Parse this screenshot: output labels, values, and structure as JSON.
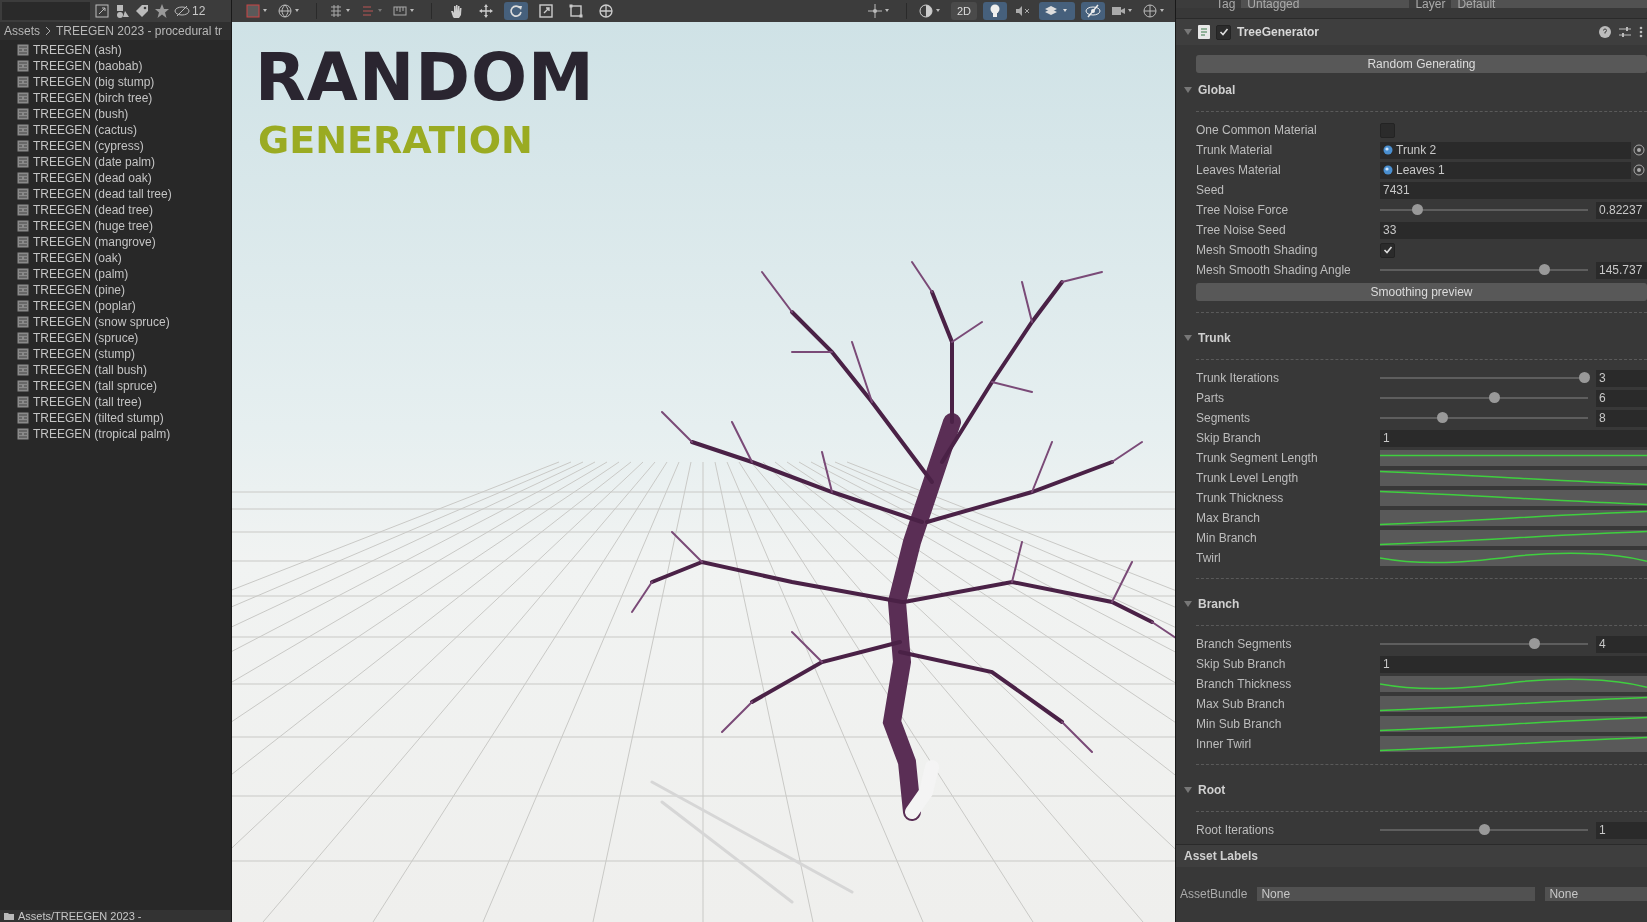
{
  "project": {
    "toolbar_badge": "12",
    "breadcrumb": [
      "Assets",
      "TREEGEN 2023 - procedural tr"
    ],
    "items": [
      "TREEGEN (ash)",
      "TREEGEN (baobab)",
      "TREEGEN (big stump)",
      "TREEGEN (birch tree)",
      "TREEGEN (bush)",
      "TREEGEN (cactus)",
      "TREEGEN (cypress)",
      "TREEGEN (date palm)",
      "TREEGEN (dead oak)",
      "TREEGEN (dead tall tree)",
      "TREEGEN (dead tree)",
      "TREEGEN (huge tree)",
      "TREEGEN (mangrove)",
      "TREEGEN (oak)",
      "TREEGEN (palm)",
      "TREEGEN (pine)",
      "TREEGEN (poplar)",
      "TREEGEN (snow spruce)",
      "TREEGEN (spruce)",
      "TREEGEN (stump)",
      "TREEGEN (tall bush)",
      "TREEGEN (tall spruce)",
      "TREEGEN (tall tree)",
      "TREEGEN (tilted stump)",
      "TREEGEN (tropical palm)"
    ],
    "footer_path": "Assets/TREEGEN 2023 -"
  },
  "scene": {
    "tools": [
      {
        "kind": "hand",
        "selected": false
      },
      {
        "kind": "move",
        "selected": false
      },
      {
        "kind": "rotate",
        "selected": true
      },
      {
        "kind": "scale",
        "selected": false
      },
      {
        "kind": "rect",
        "selected": false
      },
      {
        "kind": "transform",
        "selected": false
      }
    ],
    "mode_button": "2D",
    "lighting_on": true,
    "visibility_on": true,
    "title": "RANDOM",
    "subtitle": "GENERATION"
  },
  "inspector": {
    "tag_label": "Tag",
    "tag_value": "Untagged",
    "layer_label": "Layer",
    "layer_value": "Default",
    "component": {
      "name": "TreeGenerator",
      "enabled": true
    },
    "action_button": "Random Generating",
    "sections": [
      {
        "title": "Global",
        "expanded": true,
        "rows": [
          {
            "kind": "checkbox",
            "label": "One Common Material",
            "checked": false
          },
          {
            "kind": "object",
            "label": "Trunk Material",
            "value": "Trunk 2"
          },
          {
            "kind": "object",
            "label": "Leaves Material",
            "value": "Leaves 1"
          },
          {
            "kind": "field",
            "label": "Seed",
            "value": "7431"
          },
          {
            "kind": "slider",
            "label": "Tree Noise Force",
            "level": 0.18,
            "value": "0.82237"
          },
          {
            "kind": "field",
            "label": "Tree Noise Seed",
            "value": "33"
          },
          {
            "kind": "checkbox",
            "label": "Mesh Smooth Shading",
            "checked": true
          },
          {
            "kind": "slider",
            "label": "Mesh Smooth Shading Angle",
            "level": 0.79,
            "value": "145.737"
          },
          {
            "kind": "button",
            "label": "Smoothing preview"
          }
        ]
      },
      {
        "title": "Trunk",
        "expanded": true,
        "rows": [
          {
            "kind": "slider",
            "label": "Trunk Iterations",
            "level": 0.98,
            "value": "3"
          },
          {
            "kind": "slider",
            "label": "Parts",
            "level": 0.55,
            "value": "6"
          },
          {
            "kind": "slider",
            "label": "Segments",
            "level": 0.3,
            "value": "8"
          },
          {
            "kind": "field",
            "label": "Skip Branch",
            "value": "1"
          },
          {
            "kind": "curve",
            "label": "Trunk Segment Length"
          },
          {
            "kind": "curve",
            "label": "Trunk Level Length"
          },
          {
            "kind": "curve",
            "label": "Trunk Thickness"
          },
          {
            "kind": "curve",
            "label": "Max Branch"
          },
          {
            "kind": "curve",
            "label": "Min Branch"
          },
          {
            "kind": "curve",
            "label": "Twirl"
          }
        ]
      },
      {
        "title": "Branch",
        "expanded": true,
        "rows": [
          {
            "kind": "slider",
            "label": "Branch Segments",
            "level": 0.74,
            "value": "4"
          },
          {
            "kind": "field",
            "label": "Skip Sub Branch",
            "value": "1"
          },
          {
            "kind": "curve",
            "label": "Branch Thickness"
          },
          {
            "kind": "curve",
            "label": "Max Sub Branch"
          },
          {
            "kind": "curve",
            "label": "Min Sub Branch"
          },
          {
            "kind": "curve",
            "label": "Inner Twirl"
          }
        ]
      },
      {
        "title": "Root",
        "expanded": true,
        "rows": [
          {
            "kind": "slider",
            "label": "Root Iterations",
            "level": 0.5,
            "value": "1"
          }
        ]
      }
    ],
    "asset_labels": "Asset Labels",
    "asset_bundle": {
      "label": "AssetBundle",
      "value": "None",
      "variant": "None"
    }
  }
}
